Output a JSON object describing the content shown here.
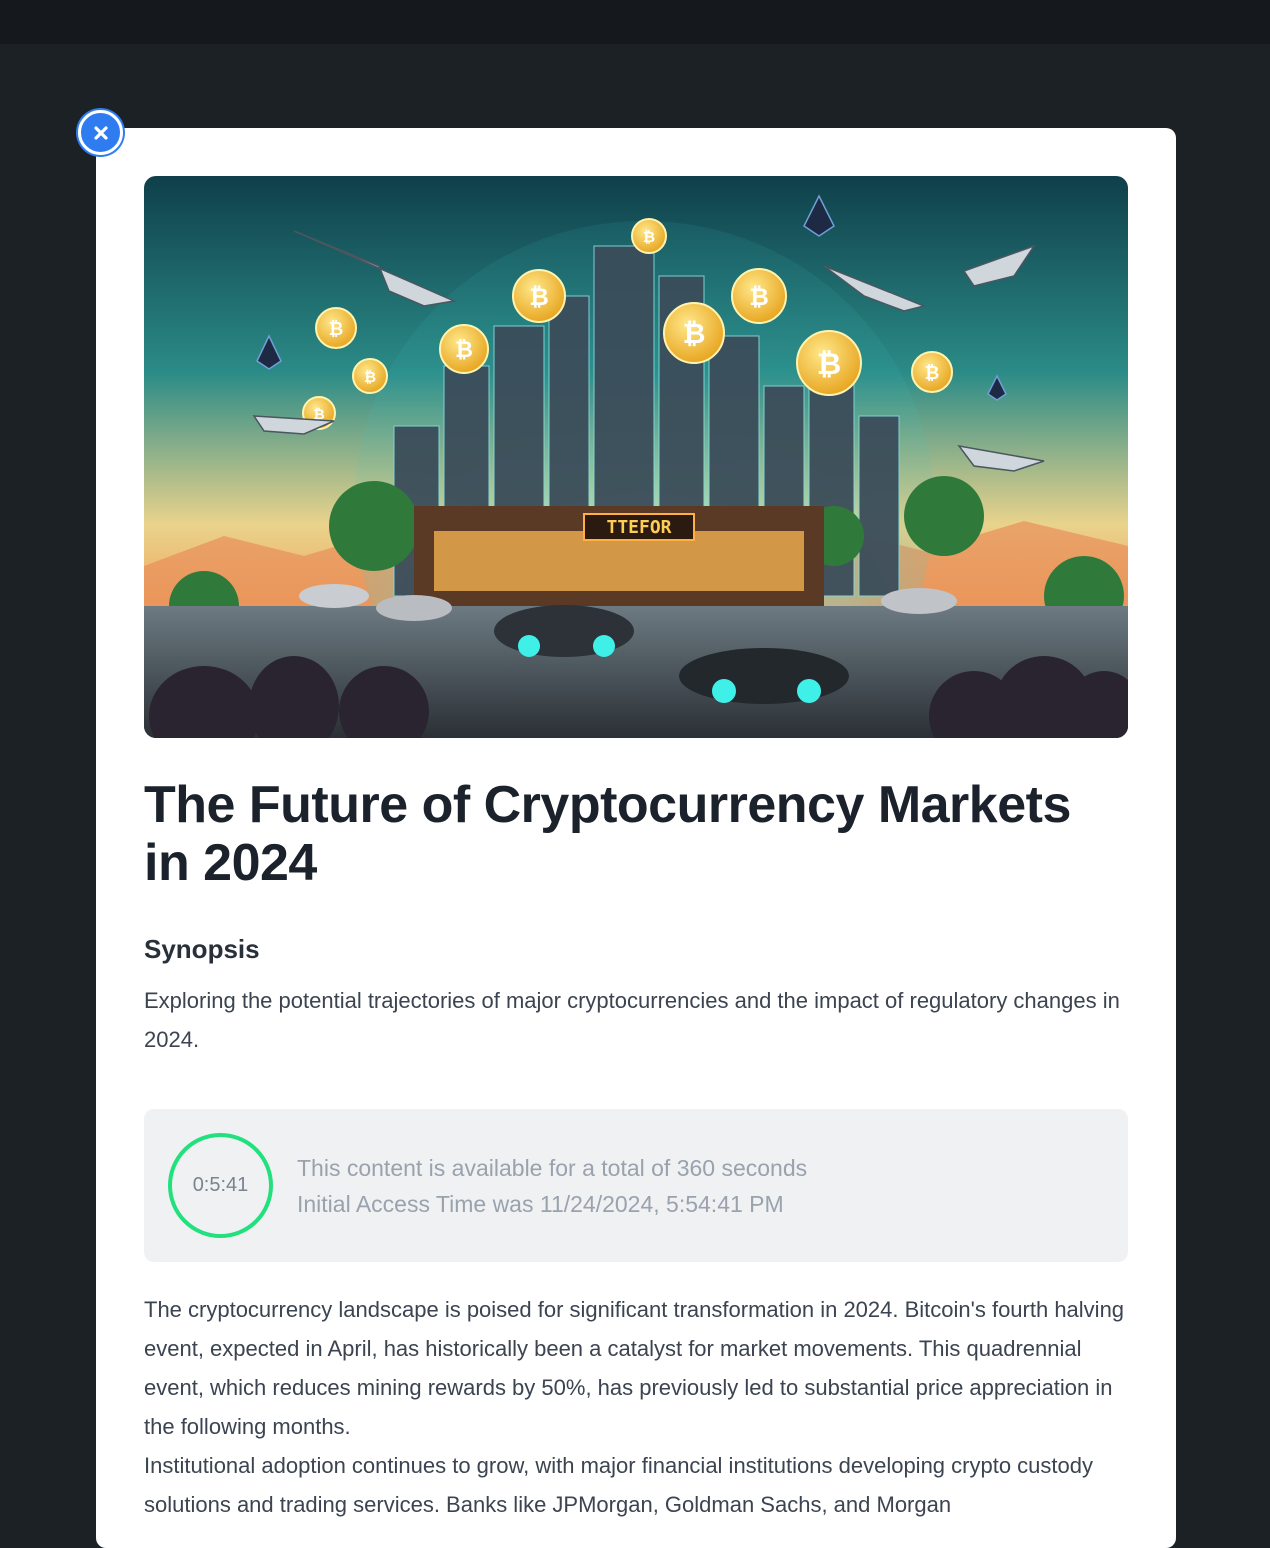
{
  "article": {
    "hero_image_alt": "Futuristic crypto city illustration",
    "title": "The Future of Cryptocurrency Markets in 2024",
    "synopsis_heading": "Synopsis",
    "synopsis": "Exploring the potential trajectories of major cryptocurrencies and the impact of regulatory changes in 2024.",
    "body_paragraphs": [
      "The cryptocurrency landscape is poised for significant transformation in 2024. Bitcoin's fourth halving event, expected in April, has historically been a catalyst for market movements. This quadrennial event, which reduces mining rewards by 50%, has previously led to substantial price appreciation in the following months.",
      "Institutional adoption continues to grow, with major financial institutions developing crypto custody solutions and trading services. Banks like JPMorgan, Goldman Sachs, and Morgan"
    ]
  },
  "timer": {
    "countdown": "0:5:41",
    "availability_text": "This content is available for a total of 360 seconds",
    "access_time_text": "Initial Access Time was 11/24/2024, 5:54:41 PM"
  },
  "icons": {
    "close": "close-icon"
  },
  "colors": {
    "accent": "#2f7cf0",
    "timer_ring": "#22e07e",
    "background": "#1c2125"
  }
}
